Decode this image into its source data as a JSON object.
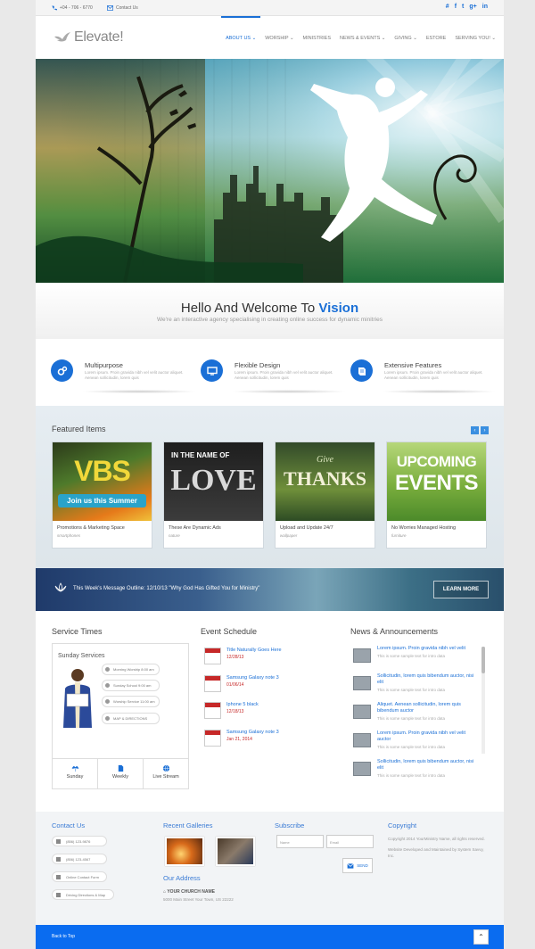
{
  "topbar": {
    "phone": "+04 - 706 - 6770",
    "contact": "Contact Us",
    "social": [
      "#",
      "f",
      "t",
      "g+",
      "in"
    ]
  },
  "logo": {
    "text": "Elevate!"
  },
  "nav": [
    {
      "label": "ABOUT US",
      "active": true,
      "caret": true
    },
    {
      "label": "WORSHIP",
      "caret": true
    },
    {
      "label": "MINISTRIES"
    },
    {
      "label": "NEWS & EVENTS",
      "caret": true
    },
    {
      "label": "GIVING",
      "caret": true
    },
    {
      "label": "ESTORE"
    },
    {
      "label": "SERVING YOU!",
      "caret": true
    }
  ],
  "welcome": {
    "title": "Hello And Welcome To ",
    "title_highlight": "Vision",
    "subtitle": "We're an interactive agency specialising in creating online success for dynamic minitries"
  },
  "features": [
    {
      "title": "Multipurpose",
      "desc": "Lorem ipsum. Proin gravida nibh vel velit auctor aliquet. Aenean sollicitudin, lorem quis",
      "icon": "cogs-icon"
    },
    {
      "title": "Flexible Design",
      "desc": "Lorem ipsum. Proin gravida nibh vel velit auctor aliquet. Aenean sollicitudin, lorem quis",
      "icon": "monitor-icon"
    },
    {
      "title": "Extensive Features",
      "desc": "Lorem ipsum. Proin gravida nibh vel velit auctor aliquet. Aenean sollicitudin, lorem quis",
      "icon": "book-icon"
    }
  ],
  "featured": {
    "heading": "Featured Items",
    "items": [
      {
        "title": "Promotions & Marketing Space",
        "sub": "smartphones",
        "img_big": "VBS",
        "img_small": "Join us this Summer"
      },
      {
        "title": "These Are Dynamic Ads",
        "sub": "nature",
        "img_big": "LOVE",
        "img_small": "IN THE NAME OF"
      },
      {
        "title": "Upload and Update 24/7",
        "sub": "wallpaper",
        "img_big": "THANKS",
        "img_small": "Give"
      },
      {
        "title": "No Worries Managed Hosting",
        "sub": "furniture",
        "img_big": "EVENTS",
        "img_small": "UPCOMING"
      }
    ]
  },
  "banner": {
    "text": "This Week's Message Outline: 12/10/13 \"Why God Has Gifted You for Ministry\"",
    "button": "LEARN MORE"
  },
  "service": {
    "heading": "Service Times",
    "box_title": "Sunday Services",
    "buttons": [
      "Morning Worship 8:00 am",
      "Sunday School 9:00 am",
      "Worship Service 11:00 am",
      "MAP & DIRECTIONS"
    ],
    "tabs": [
      "Sunday",
      "Weekly",
      "Live Stream"
    ]
  },
  "events": {
    "heading": "Event Schedule",
    "items": [
      {
        "title": "Title Naturally Goes Here",
        "date": "12/28/13"
      },
      {
        "title": "Samsung Galaxy note 3",
        "date": "01/06/14"
      },
      {
        "title": "Iphone 5 black",
        "date": "12/18/13"
      },
      {
        "title": "Samsung Galaxy note 3",
        "date": "Jan 21, 2014"
      }
    ]
  },
  "news": {
    "heading": "News & Announcements",
    "items": [
      {
        "title": "Lorem ipsum. Proin gravida nibh vel velit",
        "desc": "This is some sample text for intro data"
      },
      {
        "title": "Sollicitudin, lorem quis bibendum auctor, nisi elit",
        "desc": "This is some sample text for intro data"
      },
      {
        "title": "Aliquet. Aenean sollicitudin, lorem quis bibendum auctor",
        "desc": "This is some sample text for intro data"
      },
      {
        "title": "Lorem ipsum. Proin gravida nibh vel velit auctor",
        "desc": "This is some sample text for intro data"
      },
      {
        "title": "Sollicitudin, lorem quis bibendum auctor, nisi elit",
        "desc": "This is some sample text for intro data"
      }
    ]
  },
  "footer": {
    "contact_heading": "Contact Us",
    "contact_items": [
      "(856) 123-9876",
      "(856) 123-4567",
      "Online Contact Form",
      "Driving Directions & Map"
    ],
    "galleries_heading": "Recent Galleries",
    "address_heading": "Our Address",
    "church_name": "YOUR CHURCH NAME",
    "church_address": "5000 Main Street Your Town, US 22222",
    "subscribe_heading": "Subscribe",
    "name_placeholder": "Name",
    "email_placeholder": "Email",
    "send": "SEND",
    "copyright_heading": "Copyright",
    "copyright_text": "Copyright 2014 YourMinistry Name, all rights reserved.",
    "maintained": "Website Developed and Maintained by System Savvy, Inc."
  },
  "bottombar": {
    "back_to_top": "Back to Top"
  },
  "colors": {
    "accent": "#1a6fd6",
    "footer_bar": "#0a6cf0",
    "event_red": "#c62828"
  }
}
